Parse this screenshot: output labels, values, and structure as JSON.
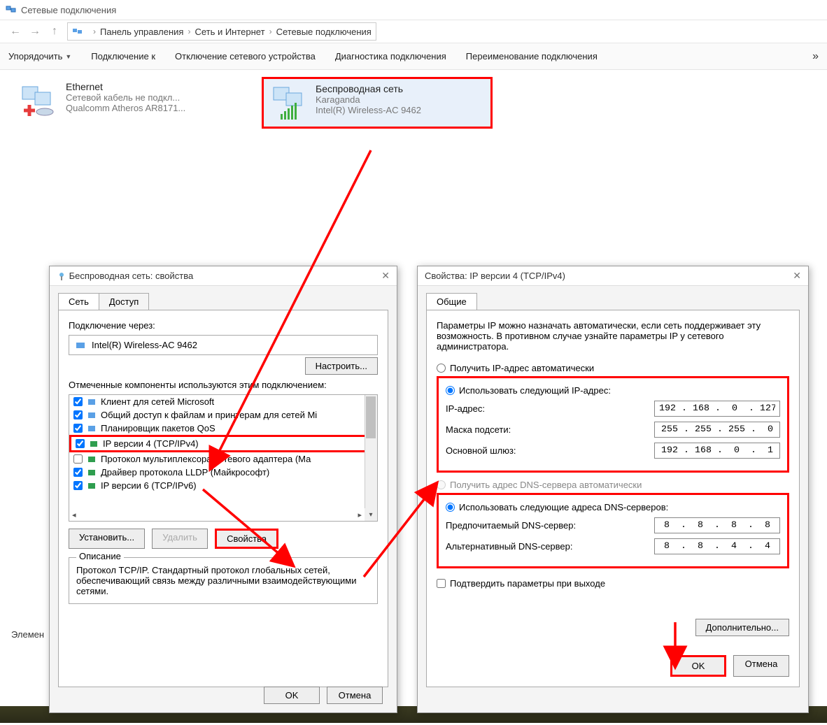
{
  "window": {
    "title": "Сетевые подключения"
  },
  "breadcrumb": {
    "items": [
      "Панель управления",
      "Сеть и Интернет",
      "Сетевые подключения"
    ]
  },
  "toolbar": {
    "organize": "Упорядочить",
    "connect": "Подключение к",
    "disable": "Отключение сетевого устройства",
    "diagnose": "Диагностика подключения",
    "rename": "Переименование подключения",
    "more": "»"
  },
  "connections": {
    "ethernet": {
      "name": "Ethernet",
      "line1": "Сетевой кабель не подкл...",
      "line2": "Qualcomm Atheros AR8171..."
    },
    "wifi": {
      "name": "Беспроводная сеть",
      "line1": "Karaganda",
      "line2": "Intel(R) Wireless-AC 9462"
    }
  },
  "dlg1": {
    "title": "Беспроводная сеть: свойства",
    "tabs": {
      "net": "Сеть",
      "access": "Доступ"
    },
    "connect_via": "Подключение через:",
    "adapter": "Intel(R) Wireless-AC 9462",
    "configure_btn": "Настроить...",
    "components_label": "Отмеченные компоненты используются этим подключением:",
    "components": [
      "Клиент для сетей Microsoft",
      "Общий доступ к файлам и принтерам для сетей Mi",
      "Планировщик пакетов QoS",
      "IP версии 4 (TCP/IPv4)",
      "Протокол мультиплексора сетевого адаптера (Ма",
      "Драйвер протокола LLDP (Майкрософт)",
      "IP версии 6 (TCP/IPv6)"
    ],
    "install_btn": "Установить...",
    "remove_btn": "Удалить",
    "props_btn": "Свойства",
    "desc_legend": "Описание",
    "desc_text": "Протокол TCP/IP. Стандартный протокол глобальных сетей, обеспечивающий связь между различными взаимодействующими сетями.",
    "ok": "OK",
    "cancel": "Отмена"
  },
  "dlg2": {
    "title": "Свойства: IP версии 4 (TCP/IPv4)",
    "tab": "Общие",
    "intro": "Параметры IP можно назначать автоматически, если сеть поддерживает эту возможность. В противном случае узнайте параметры IP у сетевого администратора.",
    "radio_auto_ip": "Получить IP-адрес автоматически",
    "radio_manual_ip": "Использовать следующий IP-адрес:",
    "ip_label": "IP-адрес:",
    "ip_value": "192 . 168 .  0  . 127",
    "mask_label": "Маска подсети:",
    "mask_value": "255 . 255 . 255 .  0",
    "gw_label": "Основной шлюз:",
    "gw_value": "192 . 168 .  0  .  1",
    "radio_auto_dns": "Получить адрес DNS-сервера автоматически",
    "radio_manual_dns": "Использовать следующие адреса DNS-серверов:",
    "dns1_label": "Предпочитаемый DNS-сервер:",
    "dns1_value": "8  .  8  .  8  .  8",
    "dns2_label": "Альтернативный DNS-сервер:",
    "dns2_value": "8  .  8  .  4  .  4",
    "confirm_exit": "Подтвердить параметры при выходе",
    "advanced": "Дополнительно...",
    "ok": "OK",
    "cancel": "Отмена"
  },
  "status": "Элемен"
}
